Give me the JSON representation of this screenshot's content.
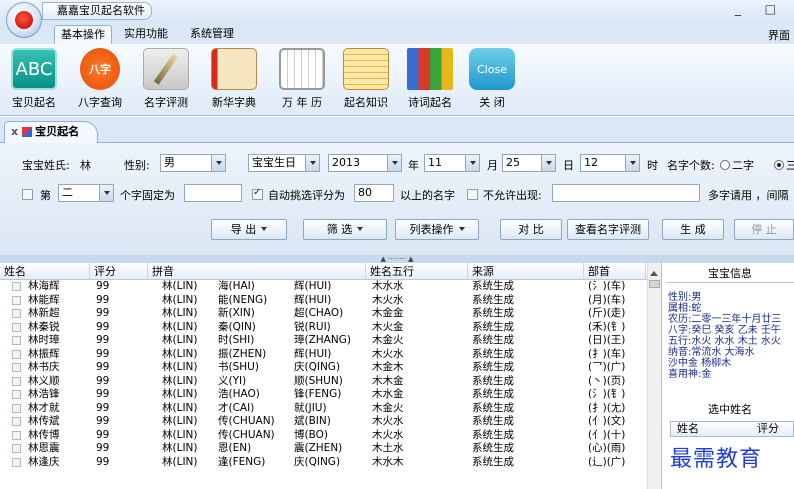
{
  "window": {
    "title": "嘉嘉宝贝起名软件",
    "controls": "_ □"
  },
  "menu": {
    "tabs": [
      "基本操作",
      "实用功能",
      "系统管理"
    ],
    "right_text": "界面"
  },
  "ribbon": {
    "buttons": [
      {
        "label": "宝贝起名",
        "icon_text": "ABC",
        "icon": "abc-icon"
      },
      {
        "label": "八字查询",
        "icon_text": "八字",
        "icon": "bazi-icon"
      },
      {
        "label": "名字评测",
        "icon_text": "",
        "icon": "pen-icon"
      },
      {
        "label": "新华字典",
        "icon_text": "",
        "icon": "book-icon"
      },
      {
        "label": "万 年 历",
        "icon_text": "",
        "icon": "calendar-icon"
      },
      {
        "label": "起名知识",
        "icon_text": "",
        "icon": "notepad-icon"
      },
      {
        "label": "诗词起名",
        "icon_text": "",
        "icon": "binders-icon"
      },
      {
        "label": "关  闭",
        "icon_text": "Close",
        "icon": "close-icon"
      }
    ]
  },
  "doc_tab": {
    "label": "宝贝起名",
    "close": "x"
  },
  "form": {
    "surname_label": "宝宝姓氏:",
    "surname_value": "林",
    "gender_label": "性别:",
    "gender_value": "男",
    "birthday_type": "宝宝生日",
    "year_value": "2013",
    "year_label": "年",
    "month_value": "11",
    "month_label": "月",
    "day_value": "25",
    "day_label": "日",
    "hour_value": "12",
    "hour_label": "时",
    "name_count_label": "名字个数:",
    "two_char_label": "二字",
    "three_char_label": "三",
    "position_label": "第",
    "position_value": "二",
    "fixed_label": "个字固定为",
    "fixed_value": "",
    "auto_pick_label": "自动挑选评分为",
    "auto_pick_value": "80",
    "above_label": "以上的名字",
    "disallow_label": "不允许出现:",
    "disallow_value": "",
    "multi_label": "多字请用 ，间隔"
  },
  "actions": {
    "export": "导  出",
    "filter": "筛  选",
    "list_ops": "列表操作",
    "compare": "对  比",
    "view_eval": "查看名字评测",
    "generate": "生  成",
    "stop": "停  止"
  },
  "splitter_text": "▲ ········ ▲",
  "table": {
    "headers": [
      "姓名",
      "评分",
      "拼音",
      "姓名五行",
      "来源",
      "部首"
    ],
    "rows": [
      {
        "name": "林海辉",
        "score": "99",
        "pinyin": [
          "林(LIN)",
          "海(HAI)",
          "辉(HUI)"
        ],
        "wuxing": "木水水",
        "source": "系统生成",
        "radical": "(氵)(车)"
      },
      {
        "name": "林能辉",
        "score": "99",
        "pinyin": [
          "林(LIN)",
          "能(NENG)",
          "辉(HUI)"
        ],
        "wuxing": "木火水",
        "source": "系统生成",
        "radical": "(月)(车)"
      },
      {
        "name": "林新超",
        "score": "99",
        "pinyin": [
          "林(LIN)",
          "新(XIN)",
          "超(CHAO)"
        ],
        "wuxing": "木金金",
        "source": "系统生成",
        "radical": "(斤)(走)"
      },
      {
        "name": "林秦锐",
        "score": "99",
        "pinyin": [
          "林(LIN)",
          "秦(QIN)",
          "锐(RUI)"
        ],
        "wuxing": "木火金",
        "source": "系统生成",
        "radical": "(禾)(钅)"
      },
      {
        "name": "林时璋",
        "score": "99",
        "pinyin": [
          "林(LIN)",
          "时(SHI)",
          "璋(ZHANG)"
        ],
        "wuxing": "木金火",
        "source": "系统生成",
        "radical": "(日)(王)"
      },
      {
        "name": "林振辉",
        "score": "99",
        "pinyin": [
          "林(LIN)",
          "振(ZHEN)",
          "辉(HUI)"
        ],
        "wuxing": "木火水",
        "source": "系统生成",
        "radical": "(扌)(车)"
      },
      {
        "name": "林书庆",
        "score": "99",
        "pinyin": [
          "林(LIN)",
          "书(SHU)",
          "庆(QING)"
        ],
        "wuxing": "木金木",
        "source": "系统生成",
        "radical": "(乛)(广)"
      },
      {
        "name": "林义顺",
        "score": "99",
        "pinyin": [
          "林(LIN)",
          "义(YI)",
          "顺(SHUN)"
        ],
        "wuxing": "木木金",
        "source": "系统生成",
        "radical": "(丶)(页)"
      },
      {
        "name": "林浩锋",
        "score": "99",
        "pinyin": [
          "林(LIN)",
          "浩(HAO)",
          "锋(FENG)"
        ],
        "wuxing": "木水金",
        "source": "系统生成",
        "radical": "(氵)(钅)"
      },
      {
        "name": "林才就",
        "score": "99",
        "pinyin": [
          "林(LIN)",
          "才(CAI)",
          "就(JIU)"
        ],
        "wuxing": "木金火",
        "source": "系统生成",
        "radical": "(扌)(尢)"
      },
      {
        "name": "林传斌",
        "score": "99",
        "pinyin": [
          "林(LIN)",
          "传(CHUAN)",
          "斌(BIN)"
        ],
        "wuxing": "木火水",
        "source": "系统生成",
        "radical": "(亻)(文)"
      },
      {
        "name": "林传博",
        "score": "99",
        "pinyin": [
          "林(LIN)",
          "传(CHUAN)",
          "博(BO)"
        ],
        "wuxing": "木火水",
        "source": "系统生成",
        "radical": "(亻)(十)"
      },
      {
        "name": "林恩震",
        "score": "99",
        "pinyin": [
          "林(LIN)",
          "恩(EN)",
          "震(ZHEN)"
        ],
        "wuxing": "木土水",
        "source": "系统生成",
        "radical": "(心)(雨)"
      },
      {
        "name": "林逢庆",
        "score": "99",
        "pinyin": [
          "林(LIN)",
          "逢(FENG)",
          "庆(QING)"
        ],
        "wuxing": "木水木",
        "source": "系统生成",
        "radical": "(辶)(广)"
      }
    ]
  },
  "info": {
    "title": "宝宝信息",
    "lines": [
      "性别:男",
      "属相:蛇",
      "农历:二零一三年十月廿三",
      "八字:癸巳 癸亥 乙未 壬午",
      "五行:水火 水水 木土 水火",
      "纳音:常流水 大海水",
      "      沙中金 杨柳木",
      "喜用神:金"
    ],
    "selected_title": "选中姓名",
    "selected_headers": [
      "姓名",
      "评分"
    ]
  },
  "watermark": "最需教育"
}
